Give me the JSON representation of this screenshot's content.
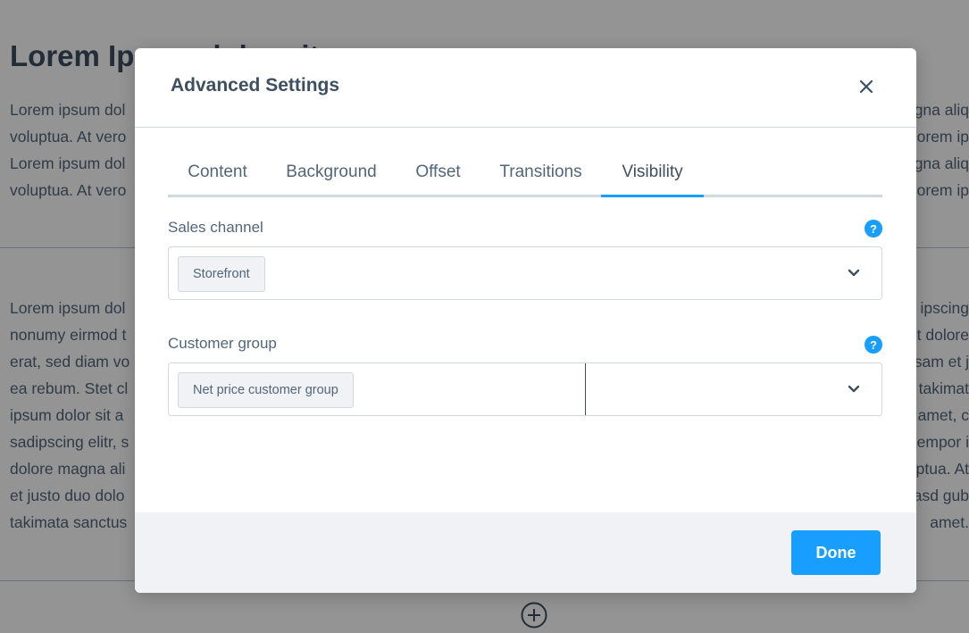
{
  "background": {
    "title": "Lorem Ipsum dolor sit",
    "paragraph1_lines": [
      [
        "Lorem ipsum dol",
        "gna aliq"
      ],
      [
        "voluptua. At vero",
        "orem ip"
      ],
      [
        "Lorem ipsum dol",
        "gna aliq"
      ],
      [
        "voluptua. At vero",
        "orem ip"
      ]
    ],
    "paragraph2_lines": [
      [
        "Lorem ipsum dol",
        "ipscing"
      ],
      [
        "nonumy eirmod t",
        "et dolore"
      ],
      [
        "erat, sed diam vo",
        "sam et j"
      ],
      [
        "ea rebum. Stet cl",
        "takimat"
      ],
      [
        "ipsum dolor sit a",
        "amet, c"
      ],
      [
        "sadipscing elitr, s",
        "empor i"
      ],
      [
        "dolore magna ali",
        "ptua. At"
      ],
      [
        "et justo duo dolo",
        "asd gub"
      ],
      [
        "takimata sanctus",
        "amet."
      ]
    ]
  },
  "modal": {
    "title": "Advanced Settings",
    "tabs": [
      {
        "label": "Content"
      },
      {
        "label": "Background"
      },
      {
        "label": "Offset"
      },
      {
        "label": "Transitions"
      },
      {
        "label": "Visibility"
      }
    ],
    "active_tab": "Visibility",
    "fields": {
      "sales_channel": {
        "label": "Sales channel",
        "selected": "Storefront",
        "help": "?"
      },
      "customer_group": {
        "label": "Customer group",
        "selected": "Net price customer group",
        "help": "?"
      }
    },
    "done_label": "Done"
  },
  "colors": {
    "accent": "#189eff",
    "text": "#52667a",
    "heading": "#3d4f61",
    "border": "#d1d9e0",
    "footer_bg": "#f0f2f5"
  },
  "icons": {
    "close": "close-icon",
    "chevron": "chevron-down-icon",
    "help": "help-icon",
    "add": "add-circle-icon"
  }
}
